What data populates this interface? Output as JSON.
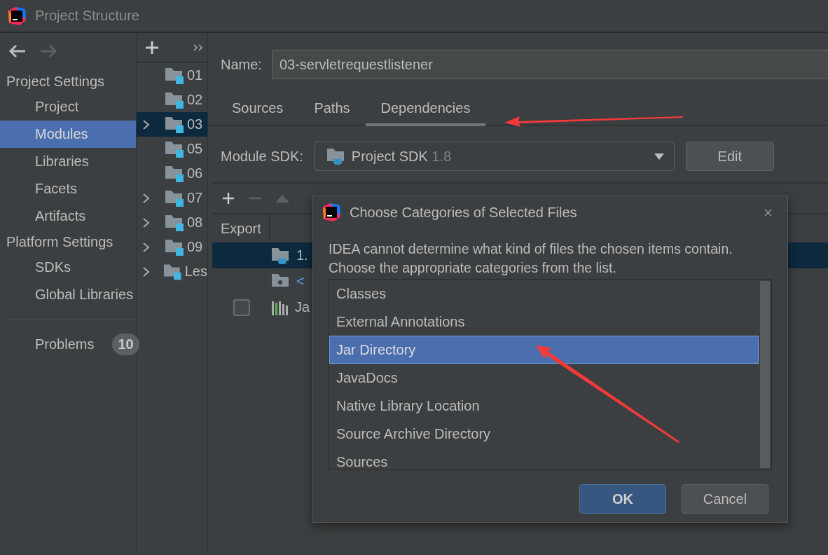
{
  "window": {
    "title": "Project Structure"
  },
  "sidebar": {
    "sections": [
      {
        "heading": "Project Settings",
        "items": [
          {
            "label": "Project",
            "selected": false
          },
          {
            "label": "Modules",
            "selected": true
          },
          {
            "label": "Libraries",
            "selected": false
          },
          {
            "label": "Facets",
            "selected": false
          },
          {
            "label": "Artifacts",
            "selected": false
          }
        ]
      },
      {
        "heading": "Platform Settings",
        "items": [
          {
            "label": "SDKs",
            "selected": false
          },
          {
            "label": "Global Libraries",
            "selected": false
          }
        ]
      }
    ],
    "problems": {
      "label": "Problems",
      "count": "10"
    }
  },
  "module_tree": {
    "items": [
      {
        "label": "01",
        "expandable": false,
        "selected": false
      },
      {
        "label": "02",
        "expandable": false,
        "selected": false
      },
      {
        "label": "03",
        "expandable": true,
        "selected": true
      },
      {
        "label": "05",
        "expandable": false,
        "selected": false
      },
      {
        "label": "06",
        "expandable": false,
        "selected": false
      },
      {
        "label": "07",
        "expandable": true,
        "selected": false
      },
      {
        "label": "08",
        "expandable": true,
        "selected": false
      },
      {
        "label": "09",
        "expandable": true,
        "selected": false
      },
      {
        "label": "Les",
        "expandable": true,
        "selected": false
      }
    ]
  },
  "module": {
    "name_label": "Name:",
    "name_value": "03-servletrequestlistener",
    "tabs": [
      {
        "label": "Sources",
        "selected": false
      },
      {
        "label": "Paths",
        "selected": false
      },
      {
        "label": "Dependencies",
        "selected": true
      }
    ],
    "sdk_label": "Module SDK:",
    "sdk_value": "Project SDK",
    "sdk_version": "1.8",
    "edit_button": "Edit"
  },
  "dependencies": {
    "header": "Export",
    "rows": [
      {
        "kind": "sdk",
        "text": "1.",
        "selected": true
      },
      {
        "kind": "source",
        "text": "<",
        "selected": false
      },
      {
        "kind": "library",
        "text": "Ja",
        "selected": false,
        "checked": false
      }
    ]
  },
  "dialog": {
    "title": "Choose Categories of Selected Files",
    "message_lines": [
      "IDEA cannot determine what kind of files the chosen items contain.",
      "Choose the appropriate categories from the list."
    ],
    "categories": [
      {
        "label": "Classes",
        "selected": false
      },
      {
        "label": "External Annotations",
        "selected": false
      },
      {
        "label": "Jar Directory",
        "selected": true
      },
      {
        "label": "JavaDocs",
        "selected": false
      },
      {
        "label": "Native Library Location",
        "selected": false
      },
      {
        "label": "Source Archive Directory",
        "selected": false
      },
      {
        "label": "Sources",
        "selected": false
      }
    ],
    "buttons": [
      {
        "label": "OK",
        "default": true
      },
      {
        "label": "Cancel",
        "default": false
      }
    ]
  }
}
